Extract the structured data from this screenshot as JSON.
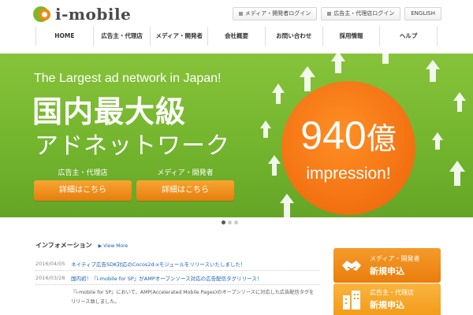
{
  "brand": {
    "logo_text": "i-mobile",
    "accent": "#f08a12",
    "green": "#7cb829"
  },
  "top_links": [
    {
      "label": "メディア・開発者ログイン",
      "icon": "square-icon"
    },
    {
      "label": "広告主・代理店ログイン",
      "icon": "square-icon"
    },
    {
      "label": "ENGLISH"
    }
  ],
  "nav": [
    "HOME",
    "広告主・代理店",
    "メディア・開発者",
    "会社概要",
    "お問い合わせ",
    "採用情報",
    "ヘルプ"
  ],
  "hero": {
    "subtitle": "The Largest ad network in Japan!",
    "title": "国内最大級",
    "title2": "アドネットワーク",
    "cta": [
      {
        "label": "広告主・代理店",
        "button": "詳細はこちら"
      },
      {
        "label": "メディア・開発者",
        "button": "詳細はこちら"
      }
    ],
    "badge_number": "940",
    "badge_unit": "億",
    "badge_text": "impression!"
  },
  "slider": {
    "current": 1,
    "total": 3
  },
  "news": {
    "title": "インフォメーション",
    "view_more": "View More",
    "items": [
      {
        "date": "2016/04/05",
        "text": "ネイティブ広告SDK対応のCocos2d-xモジュールをリリースいたしました！"
      },
      {
        "date": "2016/03/28",
        "text": "国内初！『i-mobile for SP』がAMPオープンソース対応の広告配信タグリリース！"
      }
    ],
    "body": "『i-mobile for SP』において、AMP(Accelerated Mobile Pages)のオープンソースに対応した広告配信タグを リリース致しました。"
  },
  "side": {
    "media": {
      "line1": "メディア・開発者",
      "line2": "新規申込",
      "icon": "handshake-icon"
    },
    "adv": {
      "line1": "広告主・代理店",
      "line2": "新規申込",
      "icon": "building-icon"
    }
  }
}
